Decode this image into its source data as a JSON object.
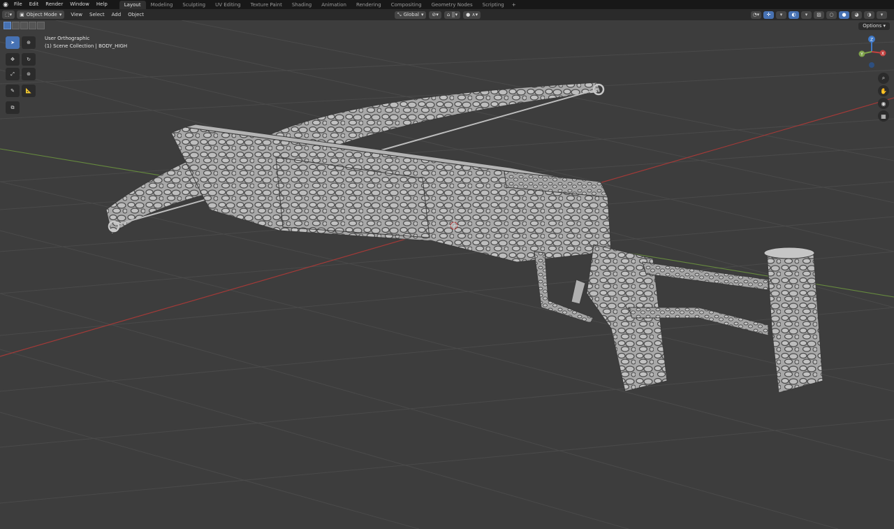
{
  "topbar": {
    "menus": [
      "File",
      "Edit",
      "Render",
      "Window",
      "Help"
    ],
    "workspaces": [
      "Layout",
      "Modeling",
      "Sculpting",
      "UV Editing",
      "Texture Paint",
      "Shading",
      "Animation",
      "Rendering",
      "Compositing",
      "Geometry Nodes",
      "Scripting"
    ],
    "active_workspace": "Layout",
    "add_tab": "+"
  },
  "header": {
    "mode": "Object Mode",
    "menus": [
      "View",
      "Select",
      "Add",
      "Object"
    ],
    "transform_orientation": "Global",
    "options_label": "Options"
  },
  "viewport": {
    "view_name": "User Orthographic",
    "collection_info": "(1) Scene Collection | BODY_HIGH"
  },
  "colors": {
    "accent": "#4772b3",
    "x_axis": "#c2413f",
    "y_axis": "#7fa34a",
    "z_axis": "#3f79c8",
    "grid_bg": "#3d3d3d"
  },
  "gizmo": {
    "x": "X",
    "y": "Y",
    "z": "Z"
  },
  "icons": {
    "tools": [
      "select-box-icon",
      "cursor-icon",
      "move-icon",
      "rotate-icon",
      "scale-icon",
      "transform-icon",
      "annotate-icon",
      "measure-icon",
      "add-cube-icon"
    ],
    "nav": [
      "zoom-icon",
      "pan-icon",
      "camera-icon",
      "grid-view-icon"
    ]
  }
}
